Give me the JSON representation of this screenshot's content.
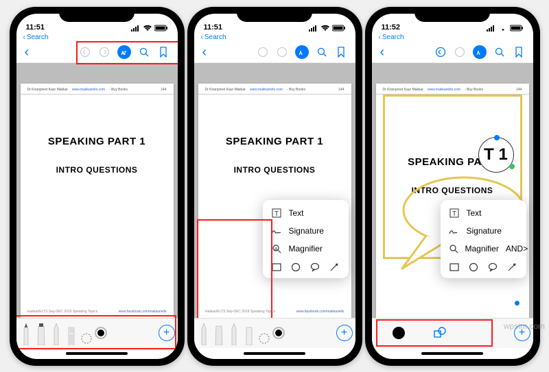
{
  "status": {
    "time1": "11:51",
    "time2": "11:51",
    "time3": "11:52",
    "search": "Search"
  },
  "doc": {
    "author": "Dr Kiranpreet Kaur Makkar",
    "site": "www.makkarielts.com",
    "buy": "- Buy Books",
    "pageno": "144",
    "title": "SPEAKING PART 1",
    "subtitle": "INTRO QUESTIONS",
    "footer_left": "makkarIELTS Sep-DEC 2019 Speaking Topics",
    "footer_link": "www.facebook.com/makkarielts"
  },
  "popover": {
    "text": "Text",
    "signature": "Signature",
    "magnifier": "Magnifier"
  },
  "magnifier_content": "T 1",
  "watermark": "wpsim.com"
}
